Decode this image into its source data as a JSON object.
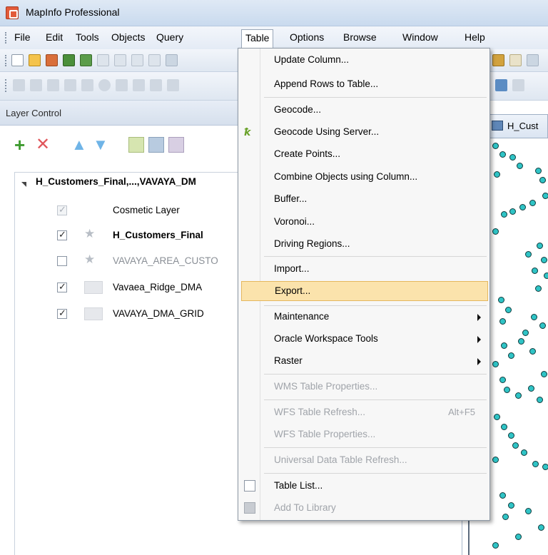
{
  "app": {
    "title": "MapInfo Professional"
  },
  "menubar": [
    "File",
    "Edit",
    "Tools",
    "Objects",
    "Query",
    "Table",
    "Options",
    "Browse",
    "Window",
    "Help"
  ],
  "layer_control": {
    "title": "Layer Control",
    "root": "H_Customers_Final,...,VAVAYA_DM",
    "layers": [
      {
        "label": "Cosmetic Layer",
        "checked": true,
        "disabled": true
      },
      {
        "label": "H_Customers_Final",
        "checked": true,
        "bold": true
      },
      {
        "label": "VAVAYA_AREA_CUSTO",
        "checked": false,
        "grey": true
      },
      {
        "label": "Vavaea_Ridge_DMA",
        "checked": true
      },
      {
        "label": "VAVAYA_DMA_GRID",
        "checked": true
      }
    ]
  },
  "map_window": {
    "tab_label": "H_Cust"
  },
  "table_menu": {
    "items": [
      {
        "label": "Update Column..."
      },
      {
        "label": "Append Rows to Table..."
      },
      {
        "label": "Geocode..."
      },
      {
        "label": "Geocode Using Server..."
      },
      {
        "label": "Create Points..."
      },
      {
        "label": "Combine Objects using Column..."
      },
      {
        "label": "Buffer..."
      },
      {
        "label": "Voronoi..."
      },
      {
        "label": "Driving Regions..."
      },
      {
        "label": "Import..."
      },
      {
        "label": "Export..."
      },
      {
        "label": "Maintenance"
      },
      {
        "label": "Oracle Workspace Tools"
      },
      {
        "label": "Raster"
      },
      {
        "label": "WMS Table Properties..."
      },
      {
        "label": "WFS Table Refresh...",
        "shortcut": "Alt+F5"
      },
      {
        "label": "WFS Table Properties..."
      },
      {
        "label": "Universal Data Table Refresh..."
      },
      {
        "label": "Table List..."
      },
      {
        "label": "Add To Library"
      }
    ]
  }
}
